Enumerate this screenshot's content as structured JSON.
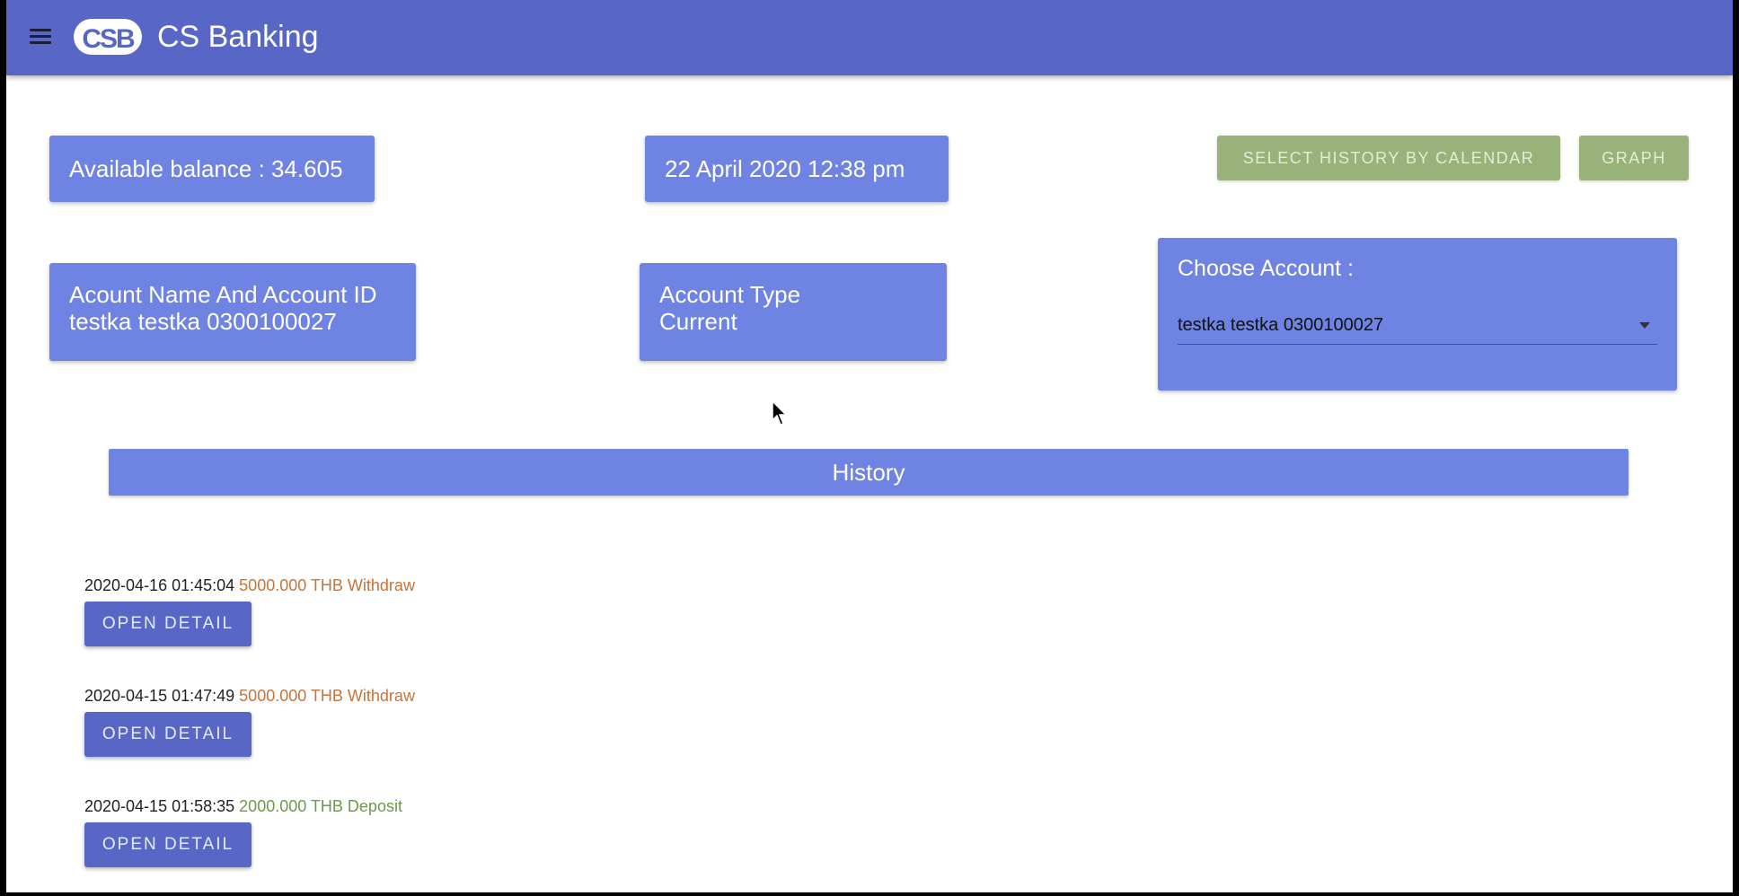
{
  "header": {
    "logo_text": "CSB",
    "title": "CS Banking",
    "menu_icon": "hamburger-menu-icon"
  },
  "summary": {
    "balance": "Available balance : 34.605",
    "datetime": "22 April 2020 12:38 pm",
    "account_name_label": "Acount Name And Account ID",
    "account_name_value": "testka testka 0300100027",
    "account_type_label": "Account Type",
    "account_type_value": "Current"
  },
  "actions": {
    "select_history_calendar": "SELECT HISTORY BY CALENDAR",
    "graph": "GRAPH"
  },
  "choose_account": {
    "label": "Choose Account :",
    "selected": "testka testka 0300100027"
  },
  "history": {
    "title": "History",
    "items": [
      {
        "timestamp": "2020-04-16 01:45:04",
        "amount": "5000.000 THB Withdraw",
        "type": "withdraw",
        "button": "OPEN DETAIL"
      },
      {
        "timestamp": "2020-04-15 01:47:49",
        "amount": "5000.000 THB Withdraw",
        "type": "withdraw",
        "button": "OPEN DETAIL"
      },
      {
        "timestamp": "2020-04-15 01:58:35",
        "amount": "2000.000 THB Deposit",
        "type": "deposit",
        "button": "OPEN DETAIL"
      }
    ]
  },
  "colors": {
    "app_bar": "#5867c6",
    "card": "#6f83e2",
    "green_button": "#99b27a",
    "withdraw": "#c6733c",
    "deposit": "#6d9a4a"
  }
}
